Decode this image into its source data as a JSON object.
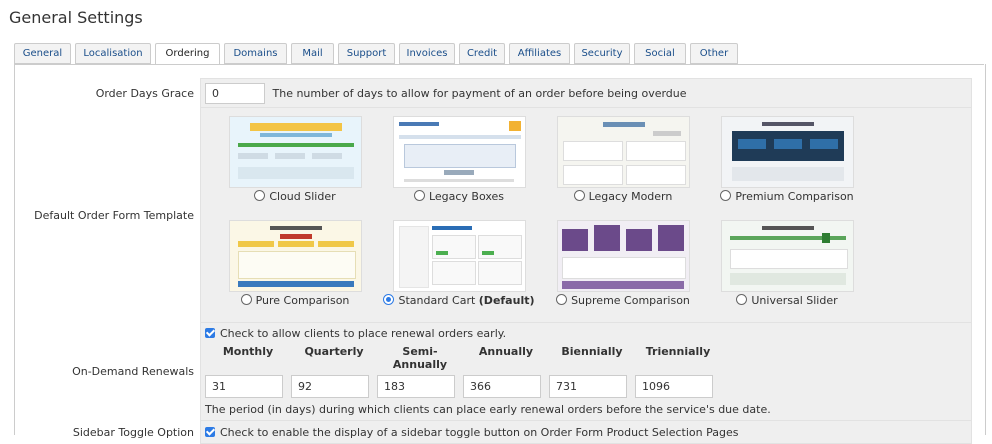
{
  "page": {
    "title": "General Settings"
  },
  "tabs": [
    "General",
    "Localisation",
    "Ordering",
    "Domains",
    "Mail",
    "Support",
    "Invoices",
    "Credit",
    "Affiliates",
    "Security",
    "Social",
    "Other"
  ],
  "active_tab": "Ordering",
  "order_days_grace": {
    "label": "Order Days Grace",
    "value": "0",
    "hint": "The number of days to allow for payment of an order before being overdue"
  },
  "order_form_template": {
    "label": "Default Order Form Template",
    "options": [
      {
        "name": "Cloud Slider",
        "selected": false,
        "suffix": ""
      },
      {
        "name": "Legacy Boxes",
        "selected": false,
        "suffix": ""
      },
      {
        "name": "Legacy Modern",
        "selected": false,
        "suffix": ""
      },
      {
        "name": "Premium Comparison",
        "selected": false,
        "suffix": ""
      },
      {
        "name": "Pure Comparison",
        "selected": false,
        "suffix": ""
      },
      {
        "name": "Standard Cart",
        "selected": true,
        "suffix": "(Default)"
      },
      {
        "name": "Supreme Comparison",
        "selected": false,
        "suffix": ""
      },
      {
        "name": "Universal Slider",
        "selected": false,
        "suffix": ""
      }
    ]
  },
  "renewals": {
    "label": "On-Demand Renewals",
    "checkbox_label": "Check to allow clients to place renewal orders early.",
    "checked": true,
    "cycles": [
      "Monthly",
      "Quarterly",
      "Semi-Annually",
      "Annually",
      "Biennially",
      "Triennially"
    ],
    "values": [
      "31",
      "92",
      "183",
      "366",
      "731",
      "1096"
    ],
    "note": "The period (in days) during which clients can place early renewal orders before the service's due date."
  },
  "sidebar_toggle": {
    "label": "Sidebar Toggle Option",
    "checkbox_label": "Check to enable the display of a sidebar toggle button on Order Form Product Selection Pages",
    "checked": true
  },
  "colors": {
    "accent": "#2d7be5",
    "link": "#1a4e8a",
    "field_bg": "#efefef"
  }
}
